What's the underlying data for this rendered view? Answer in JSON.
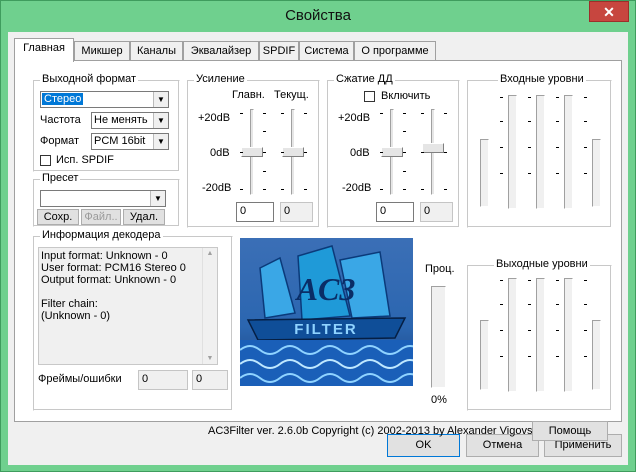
{
  "window": {
    "title": "Свойства",
    "close_glyph": "✕"
  },
  "tabs": [
    {
      "label": "Главная",
      "active": true
    },
    {
      "label": "Микшер"
    },
    {
      "label": "Каналы"
    },
    {
      "label": "Эквалайзер"
    },
    {
      "label": "SPDIF"
    },
    {
      "label": "Система"
    },
    {
      "label": "О программе"
    }
  ],
  "output_format": {
    "group_label": "Выходной формат",
    "format_value": "Стерео",
    "frequency_label": "Частота",
    "frequency_value": "Не менять",
    "format_label": "Формат",
    "format_type_value": "PCM 16bit",
    "spdif_label": "Исп. SPDIF",
    "spdif_checked": false
  },
  "preset": {
    "group_label": "Пресет",
    "value": "",
    "save_button": "Сохр.",
    "file_button": "Файл..",
    "delete_button": "Удал."
  },
  "gain": {
    "group_label": "Усиление",
    "main_label": "Главн.",
    "current_label": "Текущ.",
    "scale_top": "+20dB",
    "scale_mid": "0dB",
    "scale_bottom": "-20dB",
    "main_value": "0",
    "current_value": "0"
  },
  "drc": {
    "group_label": "Сжатие ДД",
    "enable_label": "Включить",
    "enabled": false,
    "scale_top": "+20dB",
    "scale_mid": "0dB",
    "scale_bottom": "-20dB",
    "main_value": "0",
    "current_value": "0"
  },
  "input_levels": {
    "group_label": "Входные уровни"
  },
  "output_levels": {
    "group_label": "Выходные уровни"
  },
  "decoder_info": {
    "group_label": "Информация декодера",
    "text": "Input format: Unknown - 0\nUser format: PCM16 Stereo 0\nOutput format: Unknown - 0\n\nFilter chain:\n(Unknown - 0)",
    "frames_label": "Фреймы/ошибки",
    "frames_value": "0",
    "errors_value": "0"
  },
  "cpu": {
    "label": "Проц.",
    "value": "0%",
    "level": 0
  },
  "logo": {
    "text": "AC3",
    "subtext": "FILTER"
  },
  "footer": {
    "copyright": "AC3Filter ver. 2.6.0b Copyright (c) 2002-2013 by Alexander Vigovsky",
    "help_button": "Помощь"
  },
  "dialog_buttons": {
    "ok": "OK",
    "cancel": "Отмена",
    "apply": "Применить"
  },
  "colors": {
    "titlebar": "#6fd08e",
    "close_button": "#c7463f",
    "selection": "#0078d7",
    "logo_sky": "#2b66b0",
    "logo_sail": "#1f9ad8"
  }
}
